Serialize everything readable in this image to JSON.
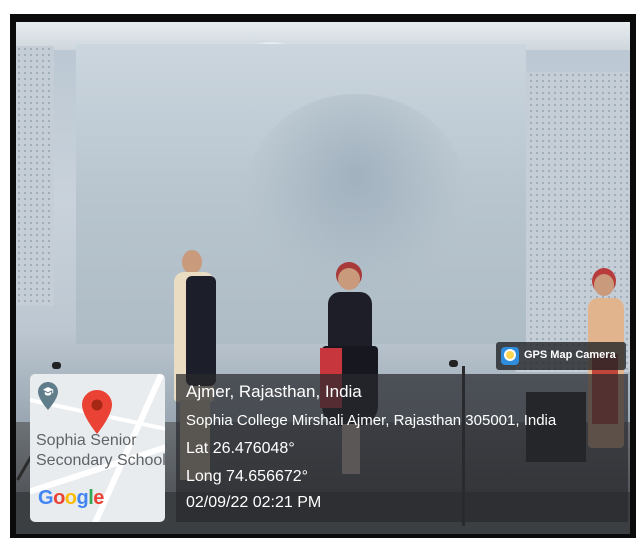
{
  "overlay": {
    "app_badge": "GPS Map Camera",
    "map": {
      "place_line1": "Sophia Senior",
      "place_line2": "Secondary School",
      "logo": {
        "g1": "G",
        "o1": "o",
        "o2": "o",
        "g2": "g",
        "l": "l",
        "e": "e"
      }
    },
    "location": {
      "title": "Ajmer, Rajasthan, India",
      "address": "Sophia College Mirshali Ajmer, Rajasthan 305001, India",
      "lat": "Lat 26.476048°",
      "long": "Long 74.656672°",
      "datetime": "02/09/22 02:21 PM"
    }
  },
  "icons": {
    "map_pin": "map-pin-icon",
    "school_pin": "school-pin-icon",
    "gps_camera": "gps-camera-icon"
  },
  "colors": {
    "pin_red": "#EA4335",
    "panel_bg": "#2a2c2e",
    "badge_bg": "#1e2024"
  }
}
